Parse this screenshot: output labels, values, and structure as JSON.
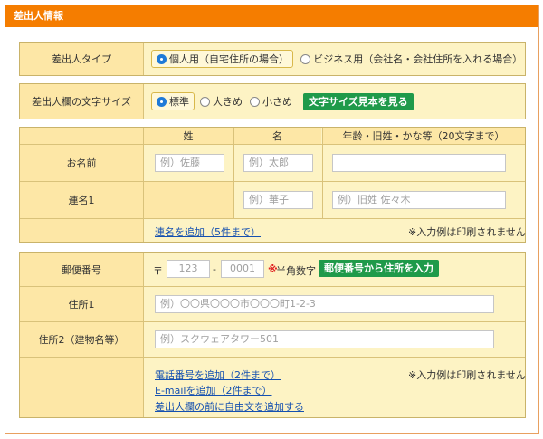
{
  "panel": {
    "title": "差出人情報"
  },
  "sender_type": {
    "label": "差出人タイプ",
    "options": [
      "個人用（自宅住所の場合）",
      "ビジネス用（会社名・会社住所を入れる場合）"
    ],
    "selected": 0
  },
  "font_size": {
    "label": "差出人欄の文字サイズ",
    "options": [
      "標準",
      "大きめ",
      "小さめ"
    ],
    "selected": 0,
    "sample_button": "文字サイズ見本を見る"
  },
  "names": {
    "col_headers": [
      "姓",
      "名",
      "年齢・旧姓・かな等（20文字まで）"
    ],
    "rows": [
      {
        "label": "お名前",
        "last_placeholder": "例）佐藤",
        "first_placeholder": "例）太郎",
        "extra_placeholder": ""
      },
      {
        "label": "連名1",
        "first_placeholder": "例）華子",
        "extra_placeholder": "例）旧姓 佐々木"
      }
    ],
    "add_link": "連名を追加（5件まで）",
    "note": "※入力例は印刷されません"
  },
  "address": {
    "postal_label": "郵便番号",
    "postal_mark": "〒",
    "postal_part1": "123",
    "postal_dash": "-",
    "postal_part2": "0001",
    "postal_hint_mark": "※",
    "postal_hint": "半角数字",
    "postal_button": "郵便番号から住所を入力",
    "addr1_label": "住所1",
    "addr1_placeholder": "例）〇〇県〇〇〇市〇〇〇町1-2-3",
    "addr2_label": "住所2（建物名等）",
    "addr2_placeholder": "例）スクウェアタワー501",
    "links": [
      "電話番号を追加（2件まで）",
      "E-mailを追加（2件まで）",
      "差出人欄の前に自由文を追加する"
    ],
    "note": "※入力例は印刷されません"
  },
  "colors": {
    "header": "#f57d00",
    "cell_bg": "#fdf3c4",
    "label_bg": "#fde7a6",
    "green_button": "#1f9a4a",
    "link": "#1550b0"
  }
}
